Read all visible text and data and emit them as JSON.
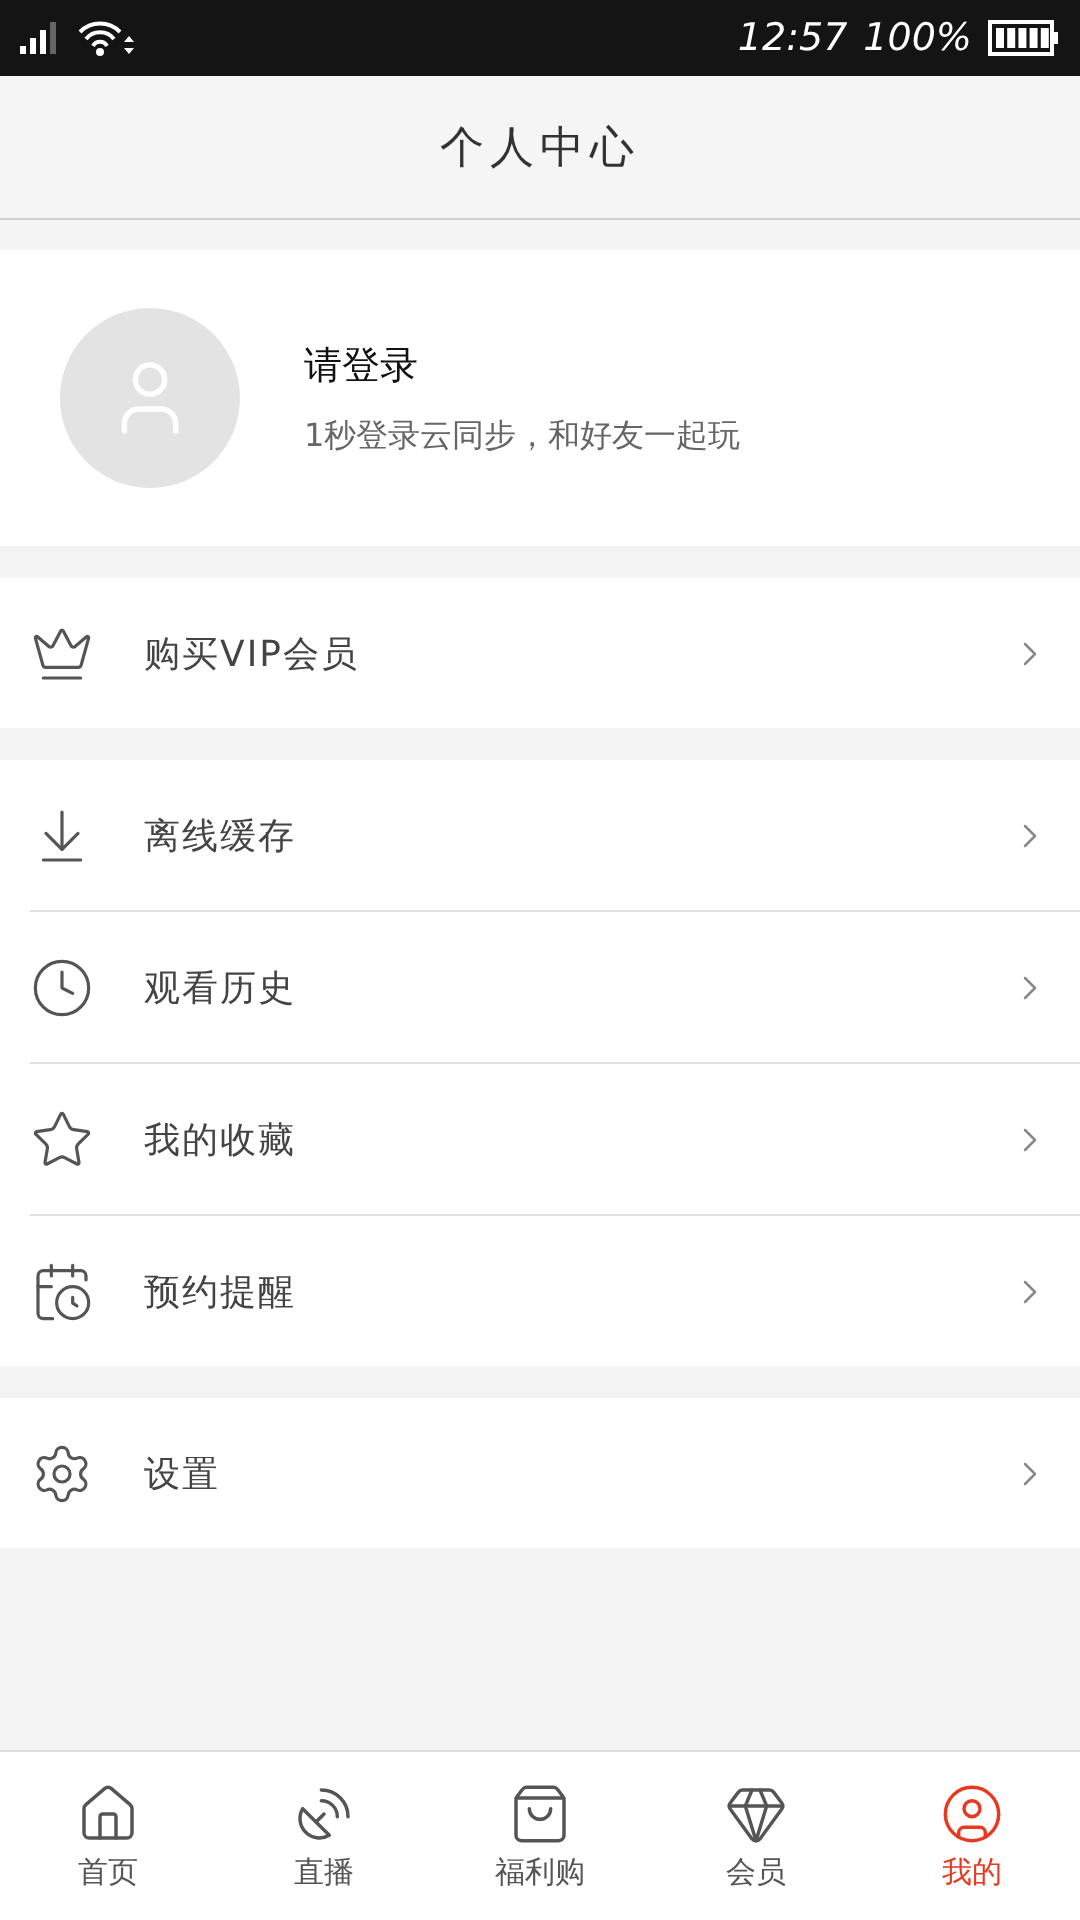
{
  "status_bar": {
    "time": "12:57",
    "battery": "100%"
  },
  "header": {
    "title": "个人中心"
  },
  "profile": {
    "title": "请登录",
    "subtitle": "1秒登录云同步，和好友一起玩"
  },
  "menu_groups": [
    [
      {
        "kind": "vip",
        "label": "购买VIP会员"
      }
    ],
    [
      {
        "kind": "download",
        "label": "离线缓存"
      },
      {
        "kind": "history",
        "label": "观看历史"
      },
      {
        "kind": "favorite",
        "label": "我的收藏"
      },
      {
        "kind": "reminder",
        "label": "预约提醒"
      }
    ],
    [
      {
        "kind": "settings",
        "label": "设置"
      }
    ]
  ],
  "tabs": [
    {
      "kind": "home",
      "label": "首页",
      "selected": false
    },
    {
      "kind": "live",
      "label": "直播",
      "selected": false
    },
    {
      "kind": "shop",
      "label": "福利购",
      "selected": false
    },
    {
      "kind": "member",
      "label": "会员",
      "selected": false
    },
    {
      "kind": "me",
      "label": "我的",
      "selected": true
    }
  ]
}
